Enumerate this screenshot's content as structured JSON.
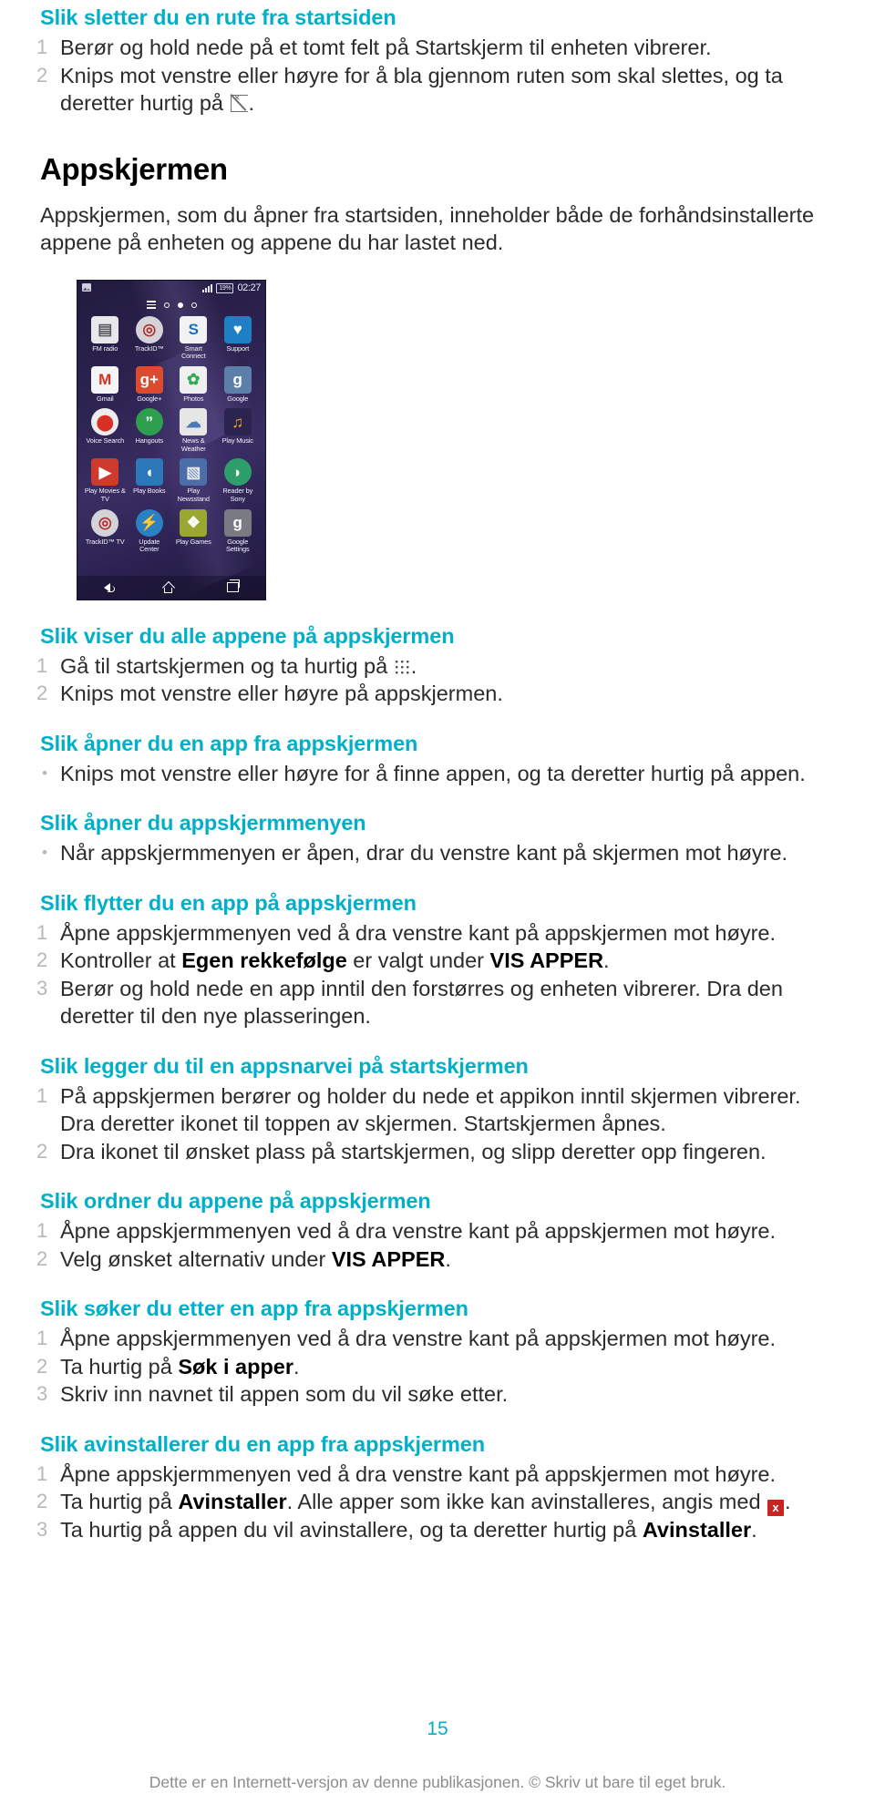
{
  "sections": [
    {
      "id": "slett-rute",
      "heading": "Slik sletter du en rute fra startsiden",
      "list_type": "ordered",
      "items": [
        {
          "marker": "1",
          "text": "Berør og hold nede på et tomt felt på Startskjerm til enheten vibrerer."
        },
        {
          "marker": "2",
          "pre": "Knips mot venstre eller høyre for å bla gjennom ruten som skal slettes, og ta deretter hurtig på ",
          "icon": "remove-panel-icon",
          "post": "."
        }
      ]
    }
  ],
  "chapter": {
    "title": "Appskjermen",
    "intro": "Appskjermen, som du åpner fra startsiden, inneholder både de forhåndsinstallerte appene på enheten og appene du har lastet ned."
  },
  "phone_screenshot": {
    "name": "xperia-app-screen-screenshot",
    "statusbar": {
      "picture_icon": "photo-icon",
      "signal_icon": "signal-bars-icon",
      "battery": "19%",
      "clock": "02:27"
    },
    "pager": {
      "menu_icon": "hamburger-icon",
      "dots": [
        "empty",
        "filled",
        "empty"
      ]
    },
    "apps": [
      {
        "label": "FM radio",
        "color": "#e8e8ea",
        "glyph": "▤",
        "glyph_color": "#5a5a62",
        "shape": "sq"
      },
      {
        "label": "TrackID™",
        "color": "#d4d4d8",
        "glyph": "◎",
        "glyph_color": "#b03030",
        "shape": "round"
      },
      {
        "label": "Smart Connect",
        "color": "#f2f2f4",
        "glyph": "S",
        "glyph_color": "#1f6fb5",
        "shape": "sq"
      },
      {
        "label": "Support",
        "color": "#1e7fc4",
        "glyph": "♥",
        "glyph_color": "#ffffff",
        "shape": "sq"
      },
      {
        "label": "Gmail",
        "color": "#f5f5f5",
        "glyph": "M",
        "glyph_color": "#d93025",
        "shape": "sq"
      },
      {
        "label": "Google+",
        "color": "#dd4b2f",
        "glyph": "g+",
        "glyph_color": "#ffffff",
        "shape": "sq"
      },
      {
        "label": "Photos",
        "color": "#f0f0f0",
        "glyph": "✿",
        "glyph_color": "#34a853",
        "shape": "sq"
      },
      {
        "label": "Google",
        "color": "#5b7fa8",
        "glyph": "g",
        "glyph_color": "#ffffff",
        "shape": "sq"
      },
      {
        "label": "Voice Search",
        "color": "#ededf0",
        "glyph": "⬤",
        "glyph_color": "#d93025",
        "shape": "round"
      },
      {
        "label": "Hangouts",
        "color": "#2e9e4f",
        "glyph": "”",
        "glyph_color": "#ffffff",
        "shape": "round"
      },
      {
        "label": "News & Weather",
        "color": "#e6e6e6",
        "glyph": "☁",
        "glyph_color": "#4a7ab5",
        "shape": "sq"
      },
      {
        "label": "Play Music",
        "color": "#2b2350",
        "glyph": "♫",
        "glyph_color": "#f0a81e",
        "shape": "sq"
      },
      {
        "label": "Play Movies & TV",
        "color": "#cc3b2e",
        "glyph": "▶",
        "glyph_color": "#ffffff",
        "shape": "sq"
      },
      {
        "label": "Play Books",
        "color": "#2b78b8",
        "glyph": "◖",
        "glyph_color": "#ffffff",
        "shape": "sq"
      },
      {
        "label": "Play Newsstand",
        "color": "#4a6fa8",
        "glyph": "▧",
        "glyph_color": "#e8e8f0",
        "shape": "sq"
      },
      {
        "label": "Reader by Sony",
        "color": "#2e9e6b",
        "glyph": "◗",
        "glyph_color": "#ffffff",
        "shape": "round"
      },
      {
        "label": "TrackID™ TV",
        "color": "#d4d4d8",
        "glyph": "◎",
        "glyph_color": "#b03030",
        "shape": "round"
      },
      {
        "label": "Update Center",
        "color": "#2b7fc4",
        "glyph": "⚡",
        "glyph_color": "#ffffff",
        "shape": "round"
      },
      {
        "label": "Play Games",
        "color": "#9aa832",
        "glyph": "❖",
        "glyph_color": "#ffffff",
        "shape": "sq"
      },
      {
        "label": "Google Settings",
        "color": "#7a7a82",
        "glyph": "g",
        "glyph_color": "#ffffff",
        "shape": "sq"
      }
    ],
    "navbar": {
      "back": "back-icon",
      "home": "home-icon",
      "recents": "recent-apps-icon"
    }
  },
  "procedures": [
    {
      "id": "vis-alle-apper",
      "heading": "Slik viser du alle appene på appskjermen",
      "list_type": "ordered",
      "items": [
        {
          "marker": "1",
          "pre": "Gå til startskjermen og ta hurtig på ",
          "icon": "app-grid-icon",
          "post": "."
        },
        {
          "marker": "2",
          "text": "Knips mot venstre eller høyre på appskjermen."
        }
      ]
    },
    {
      "id": "apne-app",
      "heading": "Slik åpner du en app fra appskjermen",
      "list_type": "bullet",
      "items": [
        {
          "marker": "•",
          "text": "Knips mot venstre eller høyre for å finne appen, og ta deretter hurtig på appen."
        }
      ]
    },
    {
      "id": "apne-appskjermmeny",
      "heading": "Slik åpner du appskjermmenyen",
      "list_type": "bullet",
      "items": [
        {
          "marker": "•",
          "text": "Når appskjermmenyen er åpen, drar du venstre kant på skjermen mot høyre."
        }
      ]
    },
    {
      "id": "flytt-app",
      "heading": "Slik flytter du en app på appskjermen",
      "list_type": "ordered",
      "items": [
        {
          "marker": "1",
          "text": "Åpne appskjermmenyen ved å dra venstre kant på appskjermen mot høyre."
        },
        {
          "marker": "2",
          "pre": "Kontroller at ",
          "bold": "Egen rekkefølge",
          "mid": " er valgt under ",
          "bold2": "VIS APPER",
          "post": "."
        },
        {
          "marker": "3",
          "text": "Berør og hold nede en app inntil den forstørres og enheten vibrerer. Dra den deretter til den nye plasseringen."
        }
      ]
    },
    {
      "id": "legg-til-snarvei",
      "heading": "Slik legger du til en appsnarvei på startskjermen",
      "list_type": "ordered",
      "items": [
        {
          "marker": "1",
          "text": "På appskjermen berører og holder du nede et appikon inntil skjermen vibrerer. Dra deretter ikonet til toppen av skjermen. Startskjermen åpnes."
        },
        {
          "marker": "2",
          "text": "Dra ikonet til ønsket plass på startskjermen, og slipp deretter opp fingeren."
        }
      ]
    },
    {
      "id": "ordne-apper",
      "heading": "Slik ordner du appene på appskjermen",
      "list_type": "ordered",
      "items": [
        {
          "marker": "1",
          "text": "Åpne appskjermmenyen ved å dra venstre kant på appskjermen mot høyre."
        },
        {
          "marker": "2",
          "pre": "Velg ønsket alternativ under ",
          "bold": "VIS APPER",
          "post": "."
        }
      ]
    },
    {
      "id": "sok-app",
      "heading": "Slik søker du etter en app fra appskjermen",
      "list_type": "ordered",
      "items": [
        {
          "marker": "1",
          "text": "Åpne appskjermmenyen ved å dra venstre kant på appskjermen mot høyre."
        },
        {
          "marker": "2",
          "pre": "Ta hurtig på ",
          "bold": "Søk i apper",
          "post": "."
        },
        {
          "marker": "3",
          "text": "Skriv inn navnet til appen som du vil søke etter."
        }
      ]
    },
    {
      "id": "avinstaller-app",
      "heading": "Slik avinstallerer du en app fra appskjermen",
      "list_type": "ordered",
      "items": [
        {
          "marker": "1",
          "text": "Åpne appskjermmenyen ved å dra venstre kant på appskjermen mot høyre."
        },
        {
          "marker": "2",
          "pre": "Ta hurtig på ",
          "bold": "Avinstaller",
          "mid": ". Alle apper som ikke kan avinstalleres, angis med ",
          "icon": "red-x-icon",
          "post": "."
        },
        {
          "marker": "3",
          "pre": "Ta hurtig på appen du vil avinstallere, og ta deretter hurtig på ",
          "bold": "Avinstaller",
          "post": "."
        }
      ]
    }
  ],
  "footer": {
    "page_number": "15",
    "note": "Dette er en Internett-versjon av denne publikasjonen. © Skriv ut bare til eget bruk."
  },
  "colors": {
    "heading_teal": "#00b0c8",
    "body_text": "#2b2b2b",
    "marker_grey": "#b8b8b8",
    "footer_grey": "#8c8c8c",
    "badge_red": "#c9241f"
  }
}
